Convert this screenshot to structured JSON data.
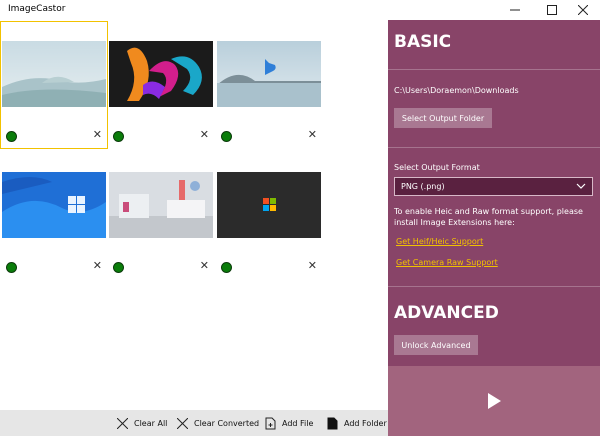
{
  "window": {
    "title": "ImageCastor",
    "minimize_icon": "minimize-icon",
    "maximize_icon": "maximize-icon",
    "close_icon": "close-icon"
  },
  "gallery": {
    "tiles": [
      {
        "image": "desert-landscape-wallpaper",
        "selected": true,
        "status_color": "#0a7d0a"
      },
      {
        "image": "colorful-ribbon-wallpaper",
        "selected": false,
        "status_color": "#0a7d0a"
      },
      {
        "image": "bing-logo-lake-wallpaper",
        "selected": false,
        "status_color": "#0a7d0a"
      },
      {
        "image": "windows-logo-blue-wallpaper",
        "selected": false,
        "status_color": "#0a7d0a"
      },
      {
        "image": "office-room-photo",
        "selected": false,
        "status_color": "#0a7d0a"
      },
      {
        "image": "windows-logo-dark-screen",
        "selected": false,
        "status_color": "#0a7d0a"
      }
    ]
  },
  "commands": {
    "clear_all": "Clear All",
    "clear_converted": "Clear Converted",
    "add_file": "Add File",
    "add_folder": "Add Folder"
  },
  "panel": {
    "basic_heading": "BASIC",
    "output_path": "C:\\Users\\Doraemon\\Downloads",
    "select_output_folder": "Select Output Folder",
    "select_output_format_label": "Select Output Format",
    "format_value": "PNG (.png)",
    "help_text": "To enable Heic and Raw format support, please install Image Extensions here:",
    "heif_link": "Get Heif/Heic Support",
    "raw_link": "Get Camera Raw Support",
    "advanced_heading": "ADVANCED",
    "unlock_advanced": "Unlock Advanced",
    "play_icon": "play-icon"
  },
  "colors": {
    "panel_bg": "#884468",
    "accent_link": "#f2c200",
    "selected_outline": "#f2c200",
    "status_ok": "#0a7d0a",
    "command_bar": "#e6e6e6"
  }
}
